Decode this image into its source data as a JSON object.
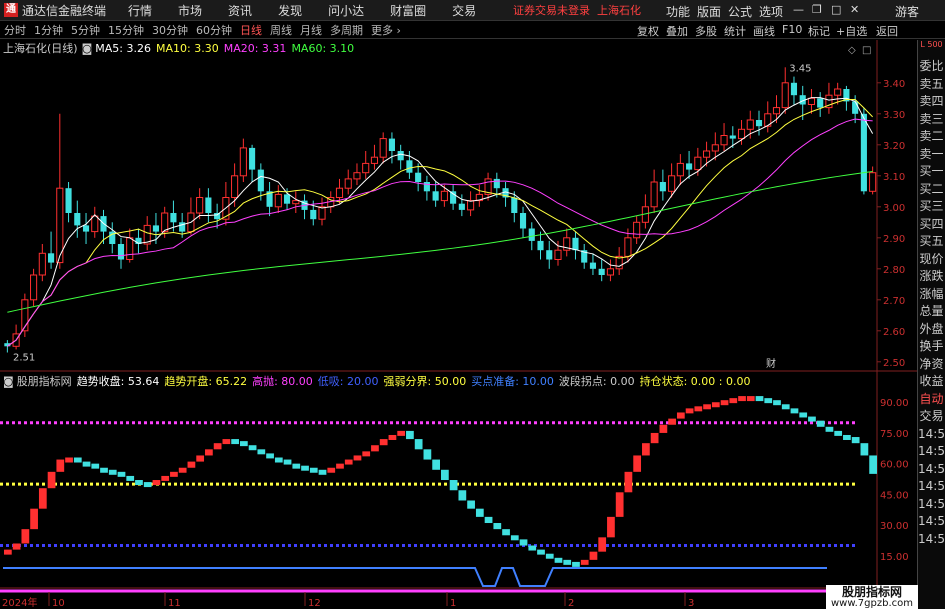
{
  "menubar": {
    "app_title": "通达信金融终端",
    "items": [
      "行情",
      "市场",
      "资讯",
      "发现",
      "问小达",
      "财富圈",
      "交易"
    ],
    "warning": "证券交易未登录",
    "stock_name": "上海石化",
    "right_items": [
      "功能",
      "版面",
      "公式",
      "选项"
    ],
    "user": "游客"
  },
  "toolbar": {
    "periods": [
      "分时",
      "1分钟",
      "5分钟",
      "15分钟",
      "30分钟",
      "60分钟",
      "日线",
      "周线",
      "月线",
      "多周期",
      "更多"
    ],
    "active_period": "日线",
    "right_items": [
      "复权",
      "叠加",
      "多股",
      "统计",
      "画线",
      "F10",
      "标记",
      "+自选",
      "返回"
    ]
  },
  "chart_header": {
    "title": "上海石化(日线)",
    "ma5_label": "MA5: 3.26",
    "ma10_label": "MA10: 3.30",
    "ma20_label": "MA20: 3.31",
    "ma60_label": "MA60: 3.10",
    "high_label": "3.45",
    "low_label": "2.51",
    "fin_marker": "财"
  },
  "indicator_header": {
    "name": "股朋指标网",
    "close_label": "趋势收盘: 53.64",
    "open_label": "趋势开盘: 65.22",
    "high_label": "高抛: 80.00",
    "low_label": "低吸: 20.00",
    "strength_label": "强弱分界: 50.00",
    "buy_label": "买点准备: 10.00",
    "wave_label": "波段拐点: 0.00",
    "hold_label": "持仓状态: 0.00 : 0.00"
  },
  "price_axis": [
    "3.40",
    "3.30",
    "3.20",
    "3.10",
    "3.00",
    "2.90",
    "2.80",
    "2.70",
    "2.60",
    "2.50"
  ],
  "ind_axis": [
    "90.00",
    "75.00",
    "60.00",
    "45.00",
    "30.00",
    "15.00"
  ],
  "date_axis": {
    "year": "2024年",
    "months": [
      "10",
      "11",
      "12",
      "1",
      "2",
      "3"
    ]
  },
  "sidebar": {
    "top": "L 500",
    "items": [
      "委比",
      "卖五",
      "卖四",
      "卖三",
      "卖二",
      "卖一",
      "买一",
      "买二",
      "买三",
      "买四",
      "买五",
      "现价",
      "涨跌",
      "涨幅",
      "总量",
      "外盘",
      "换手",
      "净资",
      "收益",
      "自动",
      "交易",
      "14:5",
      "14:5",
      "14:5",
      "14:5",
      "14:5",
      "14:5",
      "14:5"
    ]
  },
  "watermark": {
    "name": "股朋指标网",
    "url": "www.7gpzb.com"
  },
  "colors": {
    "up": "#ff3030",
    "down": "#40e0e0",
    "ma5": "#ffffff",
    "ma10": "#ffff40",
    "ma20": "#ff40ff",
    "ma60": "#40ff40",
    "blue_line": "#4080ff"
  },
  "chart_data": {
    "type": "candlestick",
    "title": "上海石化(日线)",
    "ylim": [
      2.48,
      3.48
    ],
    "candles": [
      [
        2.56,
        2.55,
        2.57,
        2.53
      ],
      [
        2.55,
        2.59,
        2.62,
        2.54
      ],
      [
        2.6,
        2.7,
        2.72,
        2.58
      ],
      [
        2.7,
        2.78,
        2.8,
        2.68
      ],
      [
        2.78,
        2.85,
        2.88,
        2.76
      ],
      [
        2.85,
        2.82,
        2.92,
        2.8
      ],
      [
        2.82,
        3.06,
        3.3,
        2.8
      ],
      [
        3.06,
        2.98,
        3.08,
        2.95
      ],
      [
        2.98,
        2.94,
        3.02,
        2.9
      ],
      [
        2.94,
        2.92,
        2.98,
        2.88
      ],
      [
        2.92,
        2.97,
        3.0,
        2.9
      ],
      [
        2.97,
        2.92,
        2.99,
        2.88
      ],
      [
        2.92,
        2.88,
        2.95,
        2.85
      ],
      [
        2.88,
        2.83,
        2.9,
        2.8
      ],
      [
        2.83,
        2.9,
        2.93,
        2.82
      ],
      [
        2.9,
        2.88,
        2.93,
        2.85
      ],
      [
        2.88,
        2.94,
        2.97,
        2.86
      ],
      [
        2.94,
        2.92,
        2.98,
        2.88
      ],
      [
        2.92,
        2.98,
        3.0,
        2.9
      ],
      [
        2.98,
        2.95,
        3.02,
        2.92
      ],
      [
        2.95,
        2.92,
        2.98,
        2.9
      ],
      [
        2.92,
        2.98,
        3.03,
        2.91
      ],
      [
        2.98,
        3.03,
        3.06,
        2.96
      ],
      [
        3.03,
        2.98,
        3.06,
        2.95
      ],
      [
        2.98,
        2.96,
        3.01,
        2.93
      ],
      [
        2.96,
        3.03,
        3.08,
        2.94
      ],
      [
        3.03,
        3.1,
        3.14,
        3.0
      ],
      [
        3.1,
        3.19,
        3.22,
        3.08
      ],
      [
        3.19,
        3.12,
        3.2,
        3.08
      ],
      [
        3.12,
        3.05,
        3.14,
        3.02
      ],
      [
        3.05,
        3.0,
        3.08,
        2.97
      ],
      [
        3.0,
        3.04,
        3.07,
        2.98
      ],
      [
        3.04,
        3.01,
        3.06,
        2.99
      ],
      [
        3.01,
        3.02,
        3.05,
        2.98
      ],
      [
        3.02,
        2.99,
        3.04,
        2.96
      ],
      [
        2.99,
        2.96,
        3.02,
        2.94
      ],
      [
        2.96,
        3.0,
        3.03,
        2.94
      ],
      [
        3.0,
        3.03,
        3.05,
        2.98
      ],
      [
        3.03,
        3.06,
        3.09,
        3.01
      ],
      [
        3.06,
        3.09,
        3.12,
        3.04
      ],
      [
        3.09,
        3.11,
        3.14,
        3.07
      ],
      [
        3.11,
        3.14,
        3.18,
        3.09
      ],
      [
        3.14,
        3.16,
        3.2,
        3.12
      ],
      [
        3.16,
        3.22,
        3.24,
        3.14
      ],
      [
        3.22,
        3.18,
        3.24,
        3.14
      ],
      [
        3.18,
        3.15,
        3.2,
        3.12
      ],
      [
        3.15,
        3.11,
        3.18,
        3.09
      ],
      [
        3.11,
        3.08,
        3.14,
        3.05
      ],
      [
        3.08,
        3.05,
        3.1,
        3.02
      ],
      [
        3.05,
        3.02,
        3.08,
        3.0
      ],
      [
        3.02,
        3.05,
        3.07,
        3.0
      ],
      [
        3.05,
        3.01,
        3.07,
        2.99
      ],
      [
        3.01,
        2.99,
        3.04,
        2.97
      ],
      [
        2.99,
        3.02,
        3.05,
        2.97
      ],
      [
        3.02,
        3.04,
        3.07,
        3.0
      ],
      [
        3.04,
        3.09,
        3.11,
        3.02
      ],
      [
        3.09,
        3.06,
        3.11,
        3.03
      ],
      [
        3.06,
        3.03,
        3.08,
        3.0
      ],
      [
        3.03,
        2.98,
        3.05,
        2.95
      ],
      [
        2.98,
        2.93,
        3.0,
        2.9
      ],
      [
        2.93,
        2.89,
        2.95,
        2.86
      ],
      [
        2.89,
        2.86,
        2.92,
        2.83
      ],
      [
        2.86,
        2.83,
        2.89,
        2.8
      ],
      [
        2.83,
        2.86,
        2.89,
        2.81
      ],
      [
        2.86,
        2.9,
        2.93,
        2.84
      ],
      [
        2.9,
        2.86,
        2.92,
        2.83
      ],
      [
        2.86,
        2.82,
        2.88,
        2.8
      ],
      [
        2.82,
        2.8,
        2.85,
        2.78
      ],
      [
        2.8,
        2.78,
        2.83,
        2.76
      ],
      [
        2.78,
        2.8,
        2.83,
        2.76
      ],
      [
        2.8,
        2.84,
        2.87,
        2.78
      ],
      [
        2.84,
        2.9,
        2.93,
        2.82
      ],
      [
        2.9,
        2.95,
        2.97,
        2.88
      ],
      [
        2.95,
        3.0,
        3.04,
        2.93
      ],
      [
        3.0,
        3.08,
        3.12,
        2.98
      ],
      [
        3.08,
        3.05,
        3.12,
        3.02
      ],
      [
        3.05,
        3.1,
        3.14,
        3.03
      ],
      [
        3.1,
        3.14,
        3.17,
        3.07
      ],
      [
        3.14,
        3.12,
        3.18,
        3.09
      ],
      [
        3.12,
        3.16,
        3.19,
        3.1
      ],
      [
        3.16,
        3.18,
        3.21,
        3.13
      ],
      [
        3.18,
        3.2,
        3.24,
        3.15
      ],
      [
        3.2,
        3.23,
        3.27,
        3.18
      ],
      [
        3.23,
        3.22,
        3.26,
        3.19
      ],
      [
        3.22,
        3.25,
        3.28,
        3.2
      ],
      [
        3.25,
        3.28,
        3.31,
        3.22
      ],
      [
        3.28,
        3.26,
        3.31,
        3.23
      ],
      [
        3.26,
        3.3,
        3.34,
        3.24
      ],
      [
        3.3,
        3.32,
        3.36,
        3.27
      ],
      [
        3.32,
        3.4,
        3.45,
        3.3
      ],
      [
        3.4,
        3.36,
        3.42,
        3.33
      ],
      [
        3.36,
        3.33,
        3.39,
        3.28
      ],
      [
        3.33,
        3.35,
        3.38,
        3.3
      ],
      [
        3.35,
        3.32,
        3.37,
        3.29
      ],
      [
        3.32,
        3.36,
        3.4,
        3.3
      ],
      [
        3.36,
        3.38,
        3.4,
        3.33
      ],
      [
        3.38,
        3.34,
        3.39,
        3.31
      ],
      [
        3.34,
        3.3,
        3.36,
        3.27
      ],
      [
        3.3,
        3.05,
        3.32,
        3.04
      ],
      [
        3.05,
        3.11,
        3.13,
        3.04
      ]
    ],
    "indicator": {
      "ylim": [
        10,
        95
      ],
      "values": [
        18,
        21,
        28,
        38,
        48,
        56,
        62,
        63,
        61,
        60,
        58,
        57,
        56,
        54,
        52,
        51,
        50,
        52,
        54,
        56,
        58,
        61,
        64,
        67,
        70,
        72,
        71,
        69,
        67,
        65,
        63,
        62,
        60,
        59,
        58,
        57,
        56,
        58,
        60,
        62,
        64,
        66,
        69,
        72,
        74,
        76,
        72,
        67,
        62,
        57,
        52,
        47,
        42,
        38,
        34,
        31,
        28,
        25,
        23,
        20,
        18,
        16,
        14,
        13,
        12,
        11,
        13,
        17,
        24,
        34,
        46,
        56,
        64,
        70,
        75,
        79,
        82,
        85,
        87,
        88,
        89,
        90,
        91,
        92,
        93,
        93,
        92,
        91,
        89,
        87,
        85,
        83,
        81,
        78,
        76,
        74,
        73,
        70,
        64,
        55
      ],
      "high_line": 80,
      "low_line": 20,
      "mid_line": 50
    }
  }
}
